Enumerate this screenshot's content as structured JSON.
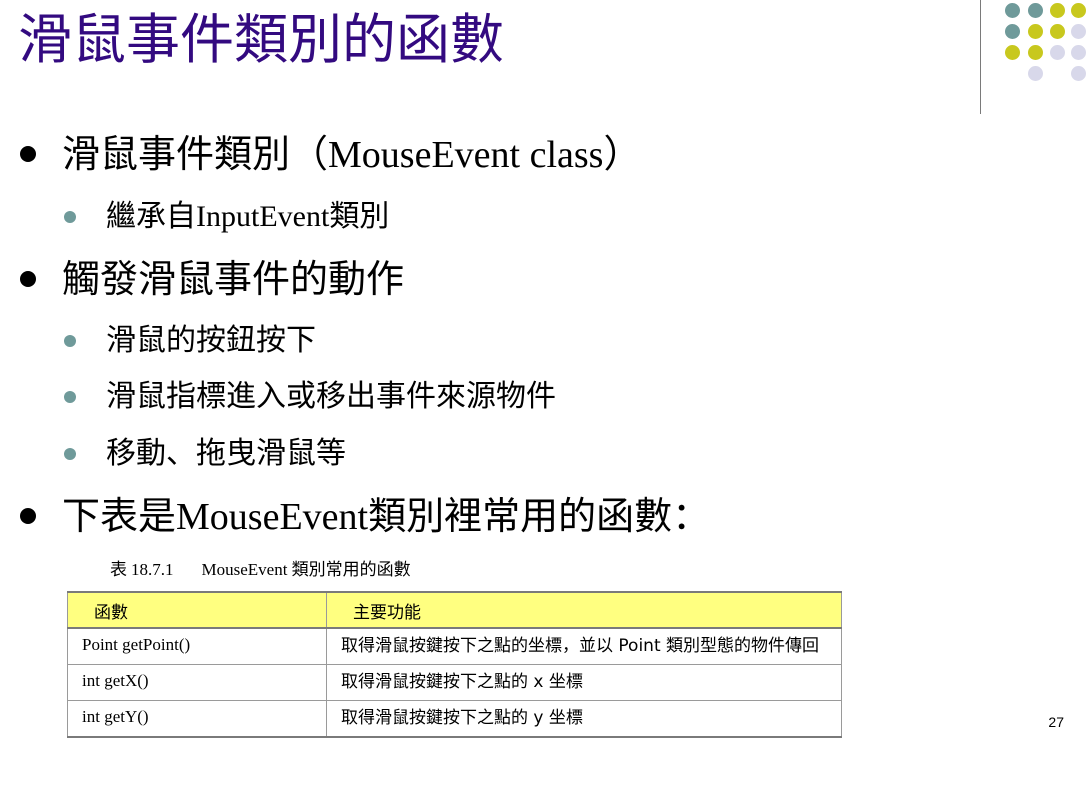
{
  "slide": {
    "title": "滑鼠事件類別的函數",
    "page_number": "27",
    "colors": {
      "title": "#330a80",
      "dot_teal": "#6f9a9a",
      "dot_yellow": "#c8c81e",
      "dot_lavender": "#d8d8ea",
      "table_header": "#ffff80"
    }
  },
  "bullets": [
    {
      "level": 1,
      "parts": [
        "滑鼠事件類別（",
        "MouseEvent class",
        "）"
      ]
    },
    {
      "level": 2,
      "parts": [
        "繼承自",
        "InputEvent",
        "類別"
      ]
    },
    {
      "level": 1,
      "parts": [
        "觸發滑鼠事件的動作",
        "",
        ""
      ]
    },
    {
      "level": 2,
      "parts": [
        "滑鼠的按鈕按下",
        "",
        ""
      ]
    },
    {
      "level": 2,
      "parts": [
        "滑鼠指標進入或移出事件來源物件",
        "",
        ""
      ]
    },
    {
      "level": 2,
      "parts": [
        "移動、拖曳滑鼠等",
        "",
        ""
      ]
    },
    {
      "level": 1,
      "parts": [
        "下表是",
        "MouseEvent",
        "類別裡常用的函數："
      ]
    }
  ],
  "table": {
    "caption_label": "表",
    "caption_number": "18.7.1",
    "caption_text": "MouseEvent 類別常用的函數",
    "headers": [
      "函數",
      "主要功能"
    ],
    "rows": [
      [
        "Point getPoint()",
        "取得滑鼠按鍵按下之點的坐標，並以 Point 類別型態的物件傳回"
      ],
      [
        "int getX()",
        "取得滑鼠按鍵按下之點的 x 坐標"
      ],
      [
        "int getY()",
        "取得滑鼠按鍵按下之點的 y 坐標"
      ]
    ]
  }
}
